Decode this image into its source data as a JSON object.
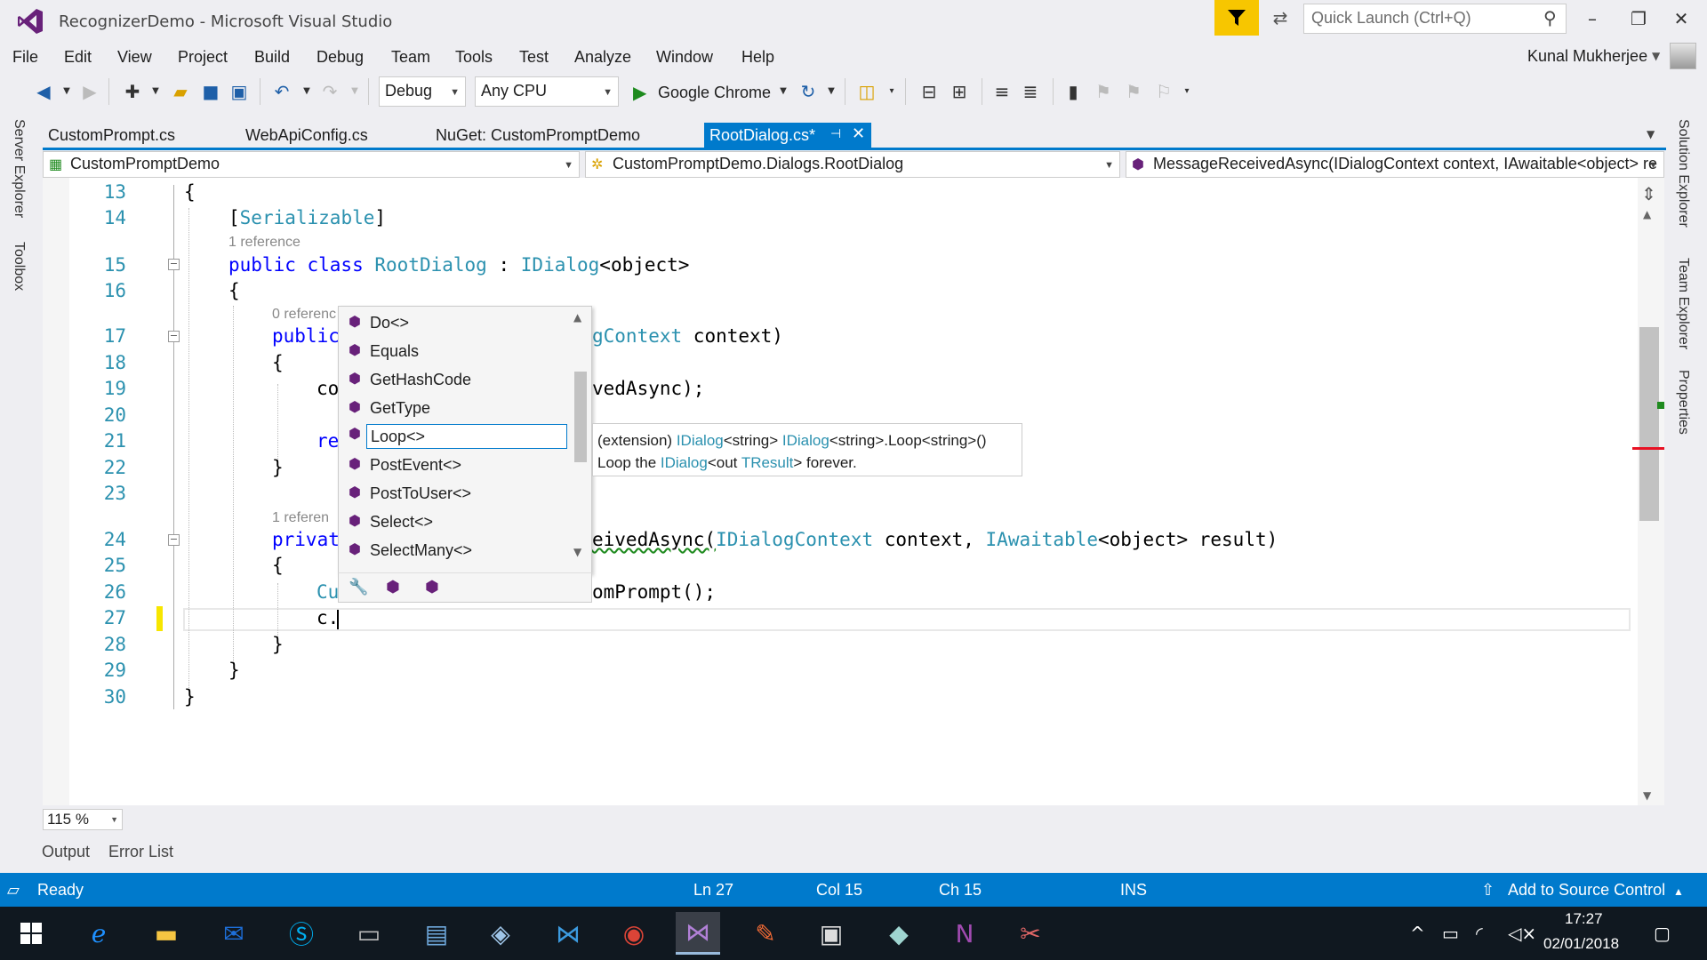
{
  "window": {
    "title": "RecognizerDemo - Microsoft Visual Studio",
    "quick_launch_placeholder": "Quick Launch (Ctrl+Q)"
  },
  "menu": [
    "File",
    "Edit",
    "View",
    "Project",
    "Build",
    "Debug",
    "Team",
    "Tools",
    "Test",
    "Analyze",
    "Window",
    "Help"
  ],
  "user": {
    "name": "Kunal Mukherjee"
  },
  "toolbar": {
    "configuration": "Debug",
    "platform": "Any CPU",
    "run_target": "Google Chrome"
  },
  "left_tabs": [
    "Server Explorer",
    "Toolbox"
  ],
  "right_tabs": [
    "Solution Explorer",
    "Team Explorer",
    "Properties"
  ],
  "doc_tabs": [
    "CustomPrompt.cs",
    "WebApiConfig.cs",
    "NuGet: CustomPromptDemo",
    "RootDialog.cs*"
  ],
  "nav": {
    "project": "CustomPromptDemo",
    "type": "CustomPromptDemo.Dialogs.RootDialog",
    "member": "MessageReceivedAsync(IDialogContext context, IAwaitable<object> re"
  },
  "code": {
    "line_numbers": [
      "13",
      "14",
      "15",
      "16",
      "17",
      "18",
      "19",
      "20",
      "21",
      "22",
      "23",
      "24",
      "25",
      "26",
      "27",
      "28",
      "29",
      "30"
    ],
    "l13": "{",
    "l14_attr": "Serializable",
    "ref1": "1 reference",
    "l15_kw": "public class",
    "l15_name": "RootDialog",
    "l15_colon": ":",
    "l15_iface": "IDialog",
    "l15_generic": "<object>",
    "l16": "{",
    "ref2": "0 referenc",
    "l17_kw": "public",
    "l17_tail_type": "gContext",
    "l17_tail": " context)",
    "l18": "{",
    "l19_head": "co",
    "l19_tail": "vedAsync);",
    "l21_head": "re",
    "l22": "}",
    "ref3": "1 referen",
    "l24_kw": "privat",
    "l24_tail_a": "eivedAsync(",
    "l24_type1": "IDialogContext",
    "l24_mid": " context, ",
    "l24_type2": "IAwaitable",
    "l24_tail_b": "<object> result)",
    "l25": "{",
    "l26_head": "Cu",
    "l26_tail": "omPrompt();",
    "l27": "c.",
    "l28": "}",
    "l29": "}",
    "l30": "}"
  },
  "completion": {
    "items": [
      "Do<>",
      "Equals",
      "GetHashCode",
      "GetType",
      "Loop<>",
      "PostEvent<>",
      "PostToUser<>",
      "Select<>",
      "SelectMany<>"
    ],
    "selected": "Loop<>"
  },
  "tooltip": {
    "line1_a": "(extension) ",
    "line1_b": "IDialog",
    "line1_c": "<string> ",
    "line1_d": "IDialog",
    "line1_e": "<string>.Loop<string>()",
    "line2_a": "Loop the ",
    "line2_b": "IDialog",
    "line2_c": "<out ",
    "line2_d": "TResult",
    "line2_e": "> forever."
  },
  "zoom": "115 %",
  "bottom_tabs": [
    "Output",
    "Error List"
  ],
  "status": {
    "state": "Ready",
    "ln": "Ln 27",
    "col": "Col 15",
    "ch": "Ch 15",
    "mode": "INS",
    "source_control": "Add to Source Control"
  },
  "clock": {
    "time": "17:27",
    "date": "02/01/2018"
  },
  "colors": {
    "accent": "#007acc",
    "keyword": "#0000ff",
    "type": "#2b91af"
  }
}
